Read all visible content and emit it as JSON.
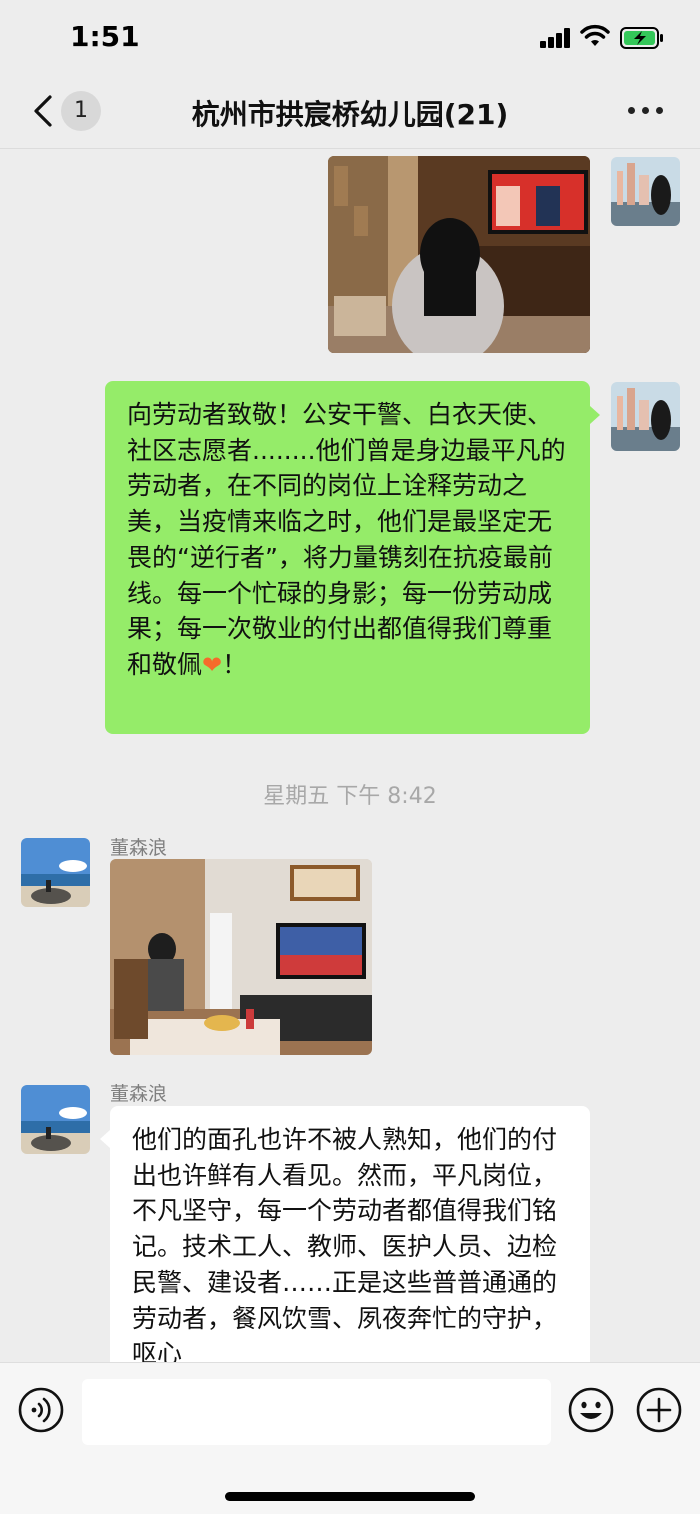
{
  "status_bar": {
    "time": "1:51"
  },
  "nav": {
    "back_icon": "chevron-left-icon",
    "unread_count": "1",
    "title": "杭州市拱宸桥幼儿园(21)",
    "more_icon": "more-horizontal-icon"
  },
  "messages": [
    {
      "type": "image",
      "side": "right",
      "description_icon": "photo"
    },
    {
      "type": "text",
      "side": "right",
      "text_before_emoji": "向劳动者致敬！公安干警、白衣天使、社区志愿者........他们曾是身边最平凡的劳动者，在不同的岗位上诠释劳动之美，当疫情来临之时，他们是最坚定无畏的“逆行者”，将力量镌刻在抗疫最前线。每一个忙碌的身影；每一份劳动成果；每一次敬业的付出都值得我们尊重和敬佩",
      "emoji": "❤",
      "text_after_emoji": "！"
    },
    {
      "type": "timestamp",
      "text": "星期五 下午 8:42"
    },
    {
      "type": "image",
      "side": "left",
      "sender": "董森浪"
    },
    {
      "type": "text",
      "side": "left",
      "sender": "董森浪",
      "text": "他们的面孔也许不被人熟知，他们的付出也许鲜有人看见。然而，平凡岗位，不凡坚守，每一个劳动者都值得我们铭记。技术工人、教师、医护人员、边检民警、建设者……正是这些普普通通的劳动者，餐风饮雪、夙夜奔忙的守护，呕心"
    }
  ],
  "input_bar": {
    "voice_icon": "voice-icon",
    "input_value": "",
    "emoji_icon": "emoji-icon",
    "plus_icon": "plus-circle-icon"
  },
  "colors": {
    "background": "#ededed",
    "self_bubble": "#95ec69",
    "other_bubble": "#ffffff",
    "battery_fill": "#34c759"
  }
}
